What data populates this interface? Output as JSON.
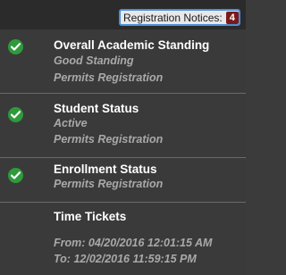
{
  "header": {
    "notices_label": "Registration Notices:",
    "notices_count": "4"
  },
  "sections": [
    {
      "title": "Overall Academic Standing",
      "lines": [
        "Good Standing",
        "Permits Registration"
      ],
      "icon": "check-circle-icon"
    },
    {
      "title": "Student Status",
      "lines": [
        "Active",
        "Permits Registration"
      ],
      "icon": "check-circle-icon"
    },
    {
      "title": "Enrollment Status",
      "lines": [
        "Permits Registration"
      ],
      "icon": "check-circle-icon"
    },
    {
      "title": "Time Tickets",
      "lines": [
        "From: 04/20/2016 12:01:15 AM",
        "To: 12/02/2016 11:59:15 PM"
      ]
    }
  ],
  "colors": {
    "check": "#2f9a3c",
    "badge": "#7a1a1a",
    "accent_border": "#4a90d9"
  }
}
